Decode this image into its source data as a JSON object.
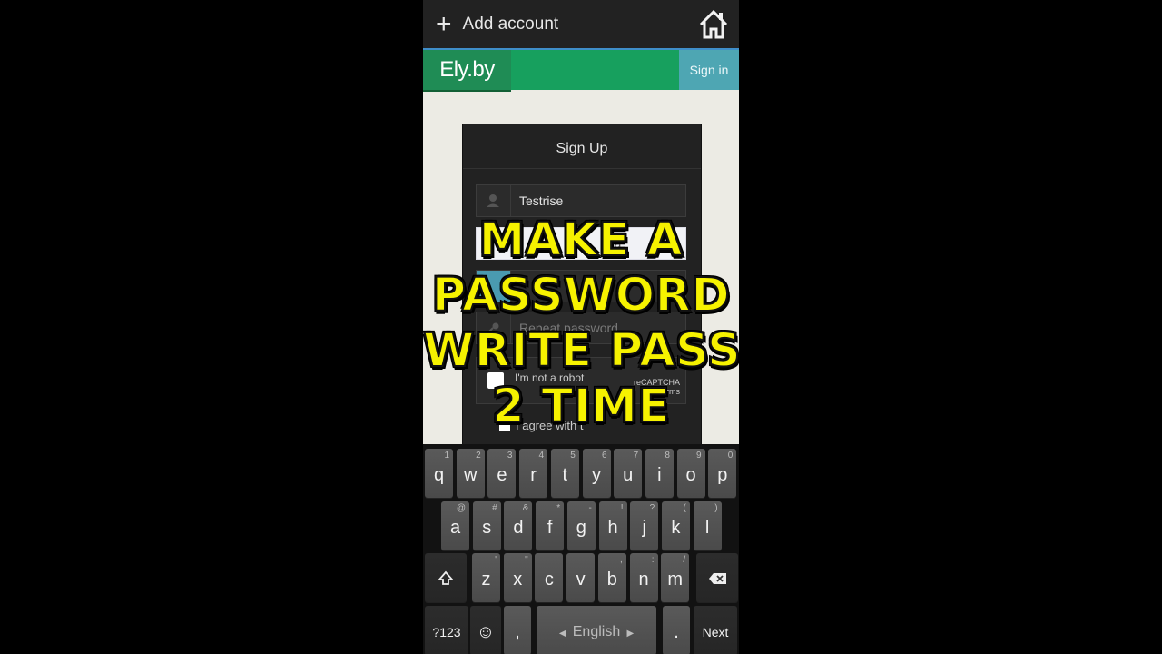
{
  "toolbar": {
    "add_account_label": "Add account",
    "add_icon": "plus-icon",
    "home_icon": "home-icon"
  },
  "site": {
    "logo": "Ely.by",
    "signin_label": "Sign in",
    "brand_color": "#17a05e"
  },
  "form": {
    "title": "Sign Up",
    "username_value": "Testrise",
    "email_partial": "ma",
    "repeat_password_placeholder": "Repeat password",
    "captcha_label": "I'm not a robot",
    "captcha_brand": "reCAPTCHA",
    "captcha_terms": "Terms",
    "agree_text": "I agree with t"
  },
  "overlay": {
    "line1": "MAKE A",
    "line2": "PASSWORD",
    "line3": "WRITE PASS",
    "line4": "2 TIME",
    "color": "#f6f200"
  },
  "keyboard": {
    "row1": [
      {
        "k": "q",
        "h": "1"
      },
      {
        "k": "w",
        "h": "2"
      },
      {
        "k": "e",
        "h": "3"
      },
      {
        "k": "r",
        "h": "4"
      },
      {
        "k": "t",
        "h": "5"
      },
      {
        "k": "y",
        "h": "6"
      },
      {
        "k": "u",
        "h": "7"
      },
      {
        "k": "i",
        "h": "8"
      },
      {
        "k": "o",
        "h": "9"
      },
      {
        "k": "p",
        "h": "0"
      }
    ],
    "row2": [
      {
        "k": "a",
        "h": "@"
      },
      {
        "k": "s",
        "h": "#"
      },
      {
        "k": "d",
        "h": "&"
      },
      {
        "k": "f",
        "h": "*"
      },
      {
        "k": "g",
        "h": "-"
      },
      {
        "k": "h",
        "h": "!"
      },
      {
        "k": "j",
        "h": "?"
      },
      {
        "k": "k",
        "h": "("
      },
      {
        "k": "l",
        "h": ")"
      }
    ],
    "row3": [
      {
        "k": "z",
        "h": "'"
      },
      {
        "k": "x",
        "h": "\""
      },
      {
        "k": "c",
        "h": ""
      },
      {
        "k": "v",
        "h": ""
      },
      {
        "k": "b",
        "h": ","
      },
      {
        "k": "n",
        "h": ":"
      },
      {
        "k": "m",
        "h": "/"
      }
    ],
    "symbols_label": "?123",
    "emoji": "☺",
    "comma": ",",
    "space_label": "English",
    "period": ".",
    "next_label": "Next"
  }
}
